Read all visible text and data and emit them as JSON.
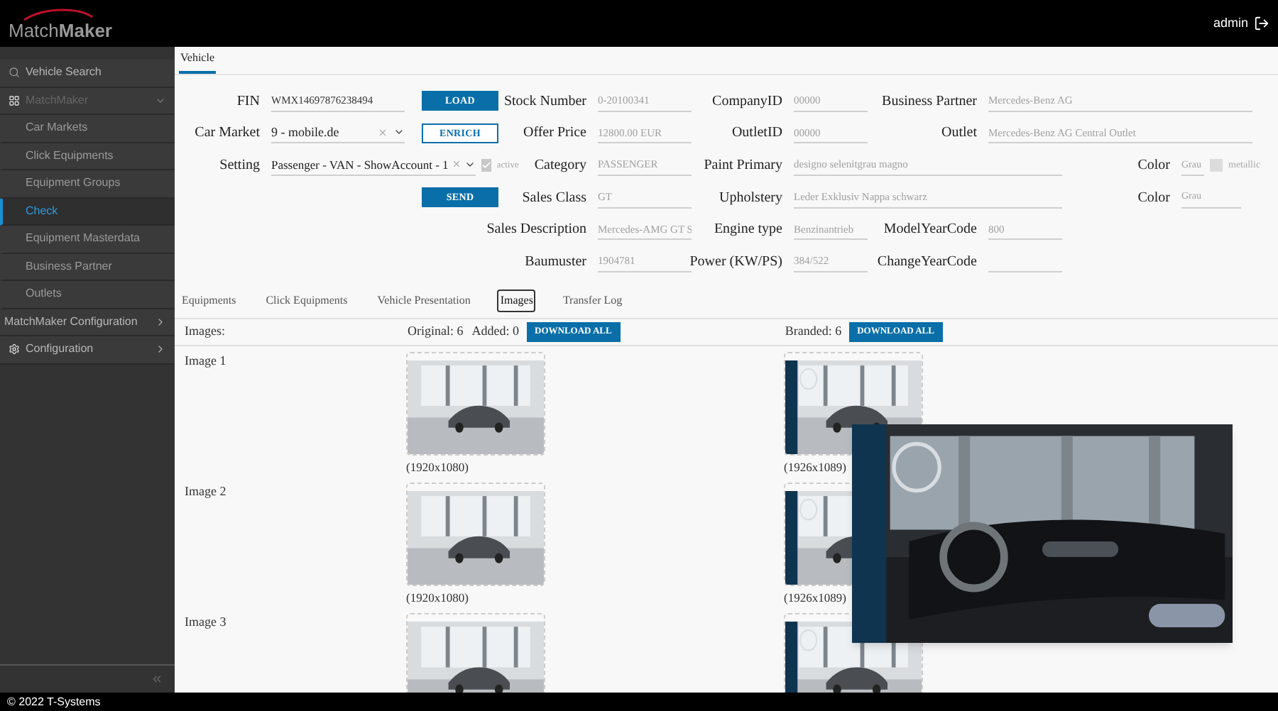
{
  "header": {
    "logo": "Match**Maker**",
    "user": "admin"
  },
  "sidebar": {
    "items": [
      {
        "kind": "link",
        "label": "Vehicle Search"
      },
      {
        "kind": "group",
        "label": "MatchMaker",
        "expanded": true,
        "children": [
          {
            "label": "Car Markets",
            "selected": false
          },
          {
            "label": "Click Equipments",
            "selected": false
          },
          {
            "label": "Equipment Groups",
            "selected": false
          },
          {
            "label": "Check",
            "selected": true
          },
          {
            "label": "Equipment Masterdata",
            "selected": false
          },
          {
            "label": "Business Partner",
            "selected": false
          },
          {
            "label": "Outlets",
            "selected": false
          }
        ]
      },
      {
        "kind": "group",
        "label": "MatchMaker Configuration",
        "expanded": false
      },
      {
        "kind": "group",
        "label": "Configuration",
        "expanded": false
      }
    ]
  },
  "top_tabs": [
    {
      "label": "Vehicle",
      "selected": true
    }
  ],
  "form": {
    "fin": {
      "label": "FIN",
      "value": "WMX14697876238494"
    },
    "car_market": {
      "label": "Car Market",
      "value": "9 - mobile.de"
    },
    "setting": {
      "label": "Setting",
      "value": "Passenger - VAN - ShowAccount - 1"
    },
    "active": {
      "label": "active",
      "checked": true
    },
    "load_button": "LOAD",
    "enrich_button": "ENRICH",
    "send_button": "SEND",
    "stock_number": {
      "label": "Stock Number",
      "value": "0-20100341"
    },
    "offer_price": {
      "label": "Offer Price",
      "value": "12800.00 EUR"
    },
    "category": {
      "label": "Category",
      "value": "PASSENGER"
    },
    "sales_class": {
      "label": "Sales Class",
      "value": "GT"
    },
    "sales_description": {
      "label": "Sales Description",
      "value": "Mercedes-AMG GT S"
    },
    "baumuster": {
      "label": "Baumuster",
      "value": "1904781"
    },
    "company_id": {
      "label": "CompanyID",
      "value": "00000"
    },
    "outlet_id": {
      "label": "OutletID",
      "value": "00000"
    },
    "paint_primary": {
      "label": "Paint Primary",
      "value": "designo selenitgrau magno"
    },
    "upholstery": {
      "label": "Upholstery",
      "value": "Leder Exklusiv Nappa schwarz"
    },
    "engine_type": {
      "label": "Engine type",
      "value": "Benzinantrieb"
    },
    "power": {
      "label": "Power (KW/PS)",
      "value": "384/522"
    },
    "business_partner": {
      "label": "Business Partner",
      "value": "Mercedes-Benz AG"
    },
    "outlet": {
      "label": "Outlet",
      "value": "Mercedes-Benz AG Central Outlet"
    },
    "model_year_code": {
      "label": "ModelYearCode",
      "value": "800"
    },
    "change_year_code": {
      "label": "ChangeYearCode"
    },
    "paint_color": {
      "label": "Color",
      "value": "Grau"
    },
    "metallic": {
      "label": "metallic",
      "checked": false
    },
    "upholstery_color": {
      "label": "Color",
      "value": "Grau"
    }
  },
  "tabs": [
    {
      "label": "Equipments",
      "selected": false
    },
    {
      "label": "Click Equipments",
      "selected": false
    },
    {
      "label": "Vehicle Presentation",
      "selected": false
    },
    {
      "label": "Images",
      "selected": true
    },
    {
      "label": "Transfer Log",
      "selected": false
    }
  ],
  "images": {
    "title": "Images:",
    "original": "Original: 6",
    "added": "Added: 0",
    "download_original": "DOWNLOAD ALL",
    "branded": "Branded: 6",
    "download_branded": "DOWNLOAD ALL",
    "rows": [
      {
        "label": "Image 1",
        "original_size": "(1920x1080)",
        "branded_size": "(1926x1089)"
      },
      {
        "label": "Image 2",
        "original_size": "(1920x1080)",
        "branded_size": "(1926x1089)"
      },
      {
        "label": "Image 3"
      }
    ]
  },
  "footer": "© 2022 T-Systems"
}
